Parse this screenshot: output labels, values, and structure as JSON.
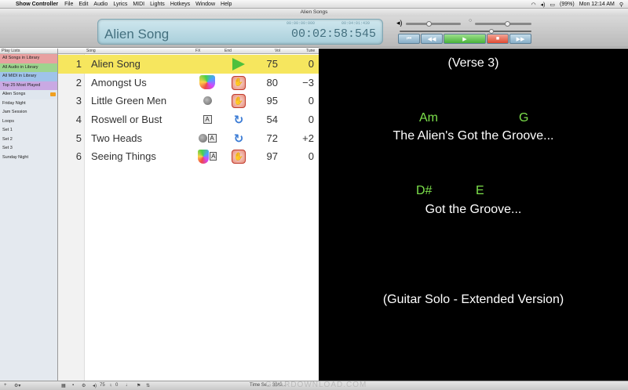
{
  "menubar": {
    "apple": "",
    "app": "Show Controller",
    "items": [
      "File",
      "Edit",
      "Audio",
      "Lyrics",
      "MIDI",
      "Lights",
      "Hotkeys",
      "Window",
      "Help"
    ],
    "battery": "(99%)",
    "clock": "Mon 12:14 AM"
  },
  "window": {
    "title": "Alien Songs"
  },
  "display": {
    "song": "Alien Song",
    "time": "00:02:58:545",
    "small_left": "00:00:00:000",
    "small_right": "00:04:01:439"
  },
  "transport": {
    "buttons": [
      "⏮",
      "◀◀",
      "▶",
      "■",
      "▶▶"
    ]
  },
  "sidebar": {
    "header": "Play Lists",
    "items": [
      {
        "label": "All Songs in Library",
        "color": "#e8a0a0"
      },
      {
        "label": "All Audio in Library",
        "color": "#9ed48e"
      },
      {
        "label": "All MIDI in Library",
        "color": "#9fc3ea"
      },
      {
        "label": "Top 25 Most Played",
        "color": "#c9a9e3"
      },
      {
        "label": "Alien Songs",
        "color": "#e4e9ef"
      },
      {
        "label": "Friday Night",
        "color": "#e4e9ef"
      },
      {
        "label": "Jam Session",
        "color": "#e4e9ef"
      },
      {
        "label": "Loops",
        "color": "#e4e9ef"
      },
      {
        "label": "Set 1",
        "color": "#e4e9ef"
      },
      {
        "label": "Set 2",
        "color": "#e4e9ef"
      },
      {
        "label": "Set 3",
        "color": "#e4e9ef"
      },
      {
        "label": "Sunday Night",
        "color": "#e4e9ef"
      }
    ]
  },
  "columns": {
    "song": "Song",
    "fx": "FX",
    "end": "End",
    "vol": "Vol",
    "tune": "Tune"
  },
  "songs": [
    {
      "num": "1",
      "title": "Alien Song",
      "fx": "",
      "end": "play",
      "vol": "75",
      "tune": "0"
    },
    {
      "num": "2",
      "title": "Amongst Us",
      "fx": "lights",
      "end": "stop",
      "vol": "80",
      "tune": "−3"
    },
    {
      "num": "3",
      "title": "Little Green Men",
      "fx": "dots",
      "end": "stop",
      "vol": "95",
      "tune": "0"
    },
    {
      "num": "4",
      "title": "Roswell or Bust",
      "fx": "A",
      "end": "loop",
      "vol": "54",
      "tune": "0"
    },
    {
      "num": "5",
      "title": "Two Heads",
      "fx": "dotsA",
      "end": "loop",
      "vol": "72",
      "tune": "+2"
    },
    {
      "num": "6",
      "title": "Seeing Things",
      "fx": "lightsA",
      "end": "stop",
      "vol": "97",
      "tune": "0"
    }
  ],
  "lyrics": {
    "verse": "(Verse 3)",
    "chords1": [
      "Am",
      "G"
    ],
    "line1": "The Alien's Got the Groove...",
    "chords2": [
      "D#",
      "E"
    ],
    "line2": "Got the Groove...",
    "solo": "(Guitar Solo - Extended Version)"
  },
  "statusbar": {
    "vol": "75",
    "tune": "0",
    "time": "Time Se... 30/G..."
  },
  "watermark": "GEARDOWNLOAD.COM"
}
